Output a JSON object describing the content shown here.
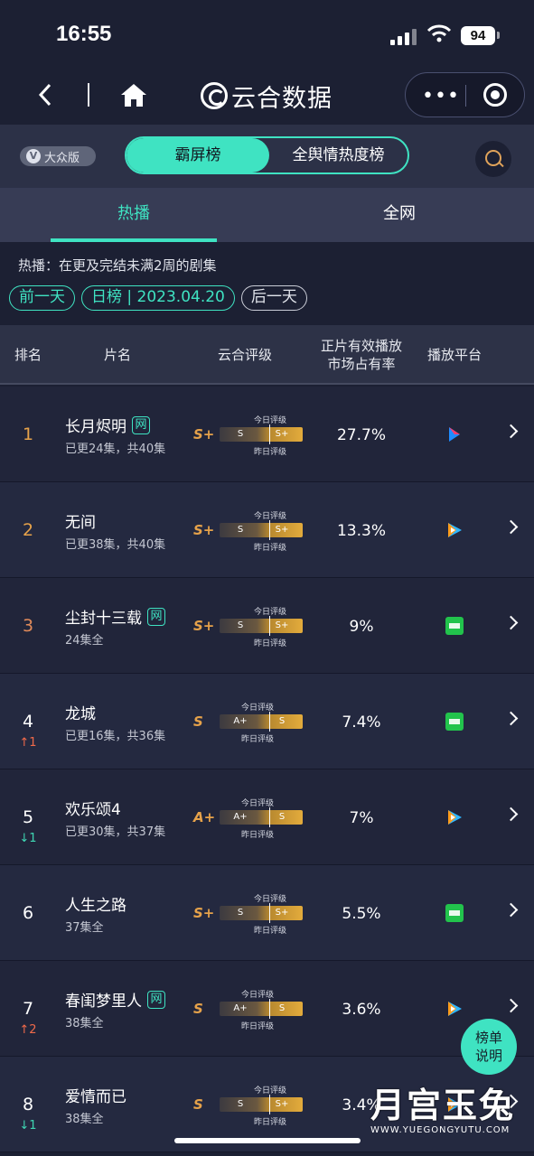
{
  "status_bar": {
    "time": "16:55",
    "battery": "94"
  },
  "nav": {
    "brand": "云合数据"
  },
  "mode": {
    "badge": "大众版",
    "segments": [
      "霸屏榜",
      "全舆情热度榜"
    ],
    "active_segment": 0
  },
  "tabs": [
    {
      "label": "热播",
      "active": true
    },
    {
      "label": "全网",
      "active": false
    }
  ],
  "description": "热播：在更及完结未满2周的剧集",
  "date_bar": {
    "prev": "前一天",
    "current": "日榜 | 2023.04.20",
    "next": "后一天"
  },
  "table": {
    "headers": {
      "rank": "排名",
      "title": "片名",
      "rating": "云合评级",
      "share": "正片有效播放\n市场占有率",
      "platform": "播放平台"
    },
    "rating_labels": {
      "today": "今日评级",
      "yesterday": "昨日评级"
    },
    "rows": [
      {
        "rank": "1",
        "change": "",
        "change_dir": "",
        "title": "长月烬明",
        "net": true,
        "net_label": "网",
        "episodes": "已更24集，共40集",
        "grade": "S+",
        "left": "S",
        "right": "S+",
        "share": "27.7%",
        "platform_icon": "youku-icon",
        "color": "#e6a24a"
      },
      {
        "rank": "2",
        "change": "",
        "change_dir": "",
        "title": "无间",
        "net": false,
        "net_label": "",
        "episodes": "已更38集，共40集",
        "grade": "S+",
        "left": "S",
        "right": "S+",
        "share": "13.3%",
        "platform_icon": "tencent-video-icon",
        "color": "#e6a24a"
      },
      {
        "rank": "3",
        "change": "",
        "change_dir": "",
        "title": "尘封十三载",
        "net": true,
        "net_label": "网",
        "episodes": "24集全",
        "grade": "S+",
        "left": "S",
        "right": "S+",
        "share": "9%",
        "platform_icon": "iqiyi-icon",
        "color": "#e08a5a"
      },
      {
        "rank": "4",
        "change": "↑1",
        "change_dir": "up",
        "title": "龙城",
        "net": false,
        "net_label": "",
        "episodes": "已更16集，共36集",
        "grade": "S",
        "left": "A+",
        "right": "S",
        "share": "7.4%",
        "platform_icon": "iqiyi-icon",
        "color": "#ffffff"
      },
      {
        "rank": "5",
        "change": "↓1",
        "change_dir": "down",
        "title": "欢乐颂4",
        "net": false,
        "net_label": "",
        "episodes": "已更30集，共37集",
        "grade": "A+",
        "left": "A+",
        "right": "S",
        "share": "7%",
        "platform_icon": "tencent-video-icon",
        "color": "#ffffff"
      },
      {
        "rank": "6",
        "change": "",
        "change_dir": "",
        "title": "人生之路",
        "net": false,
        "net_label": "",
        "episodes": "37集全",
        "grade": "S+",
        "left": "S",
        "right": "S+",
        "share": "5.5%",
        "platform_icon": "iqiyi-icon",
        "color": "#ffffff"
      },
      {
        "rank": "7",
        "change": "↑2",
        "change_dir": "up",
        "title": "春闺梦里人",
        "net": true,
        "net_label": "网",
        "episodes": "38集全",
        "grade": "S",
        "left": "A+",
        "right": "S",
        "share": "3.6%",
        "platform_icon": "tencent-video-icon",
        "color": "#ffffff"
      },
      {
        "rank": "8",
        "change": "↓1",
        "change_dir": "down",
        "title": "爱情而已",
        "net": false,
        "net_label": "",
        "episodes": "38集全",
        "grade": "S",
        "left": "S",
        "right": "S+",
        "share": "3.4%",
        "platform_icon": "tencent-video-icon",
        "color": "#ffffff"
      }
    ]
  },
  "help_button": "榜单\n说明",
  "watermark": {
    "big": "月宫玉兔",
    "small": "WWW.YUEGONGYUTU.COM"
  }
}
